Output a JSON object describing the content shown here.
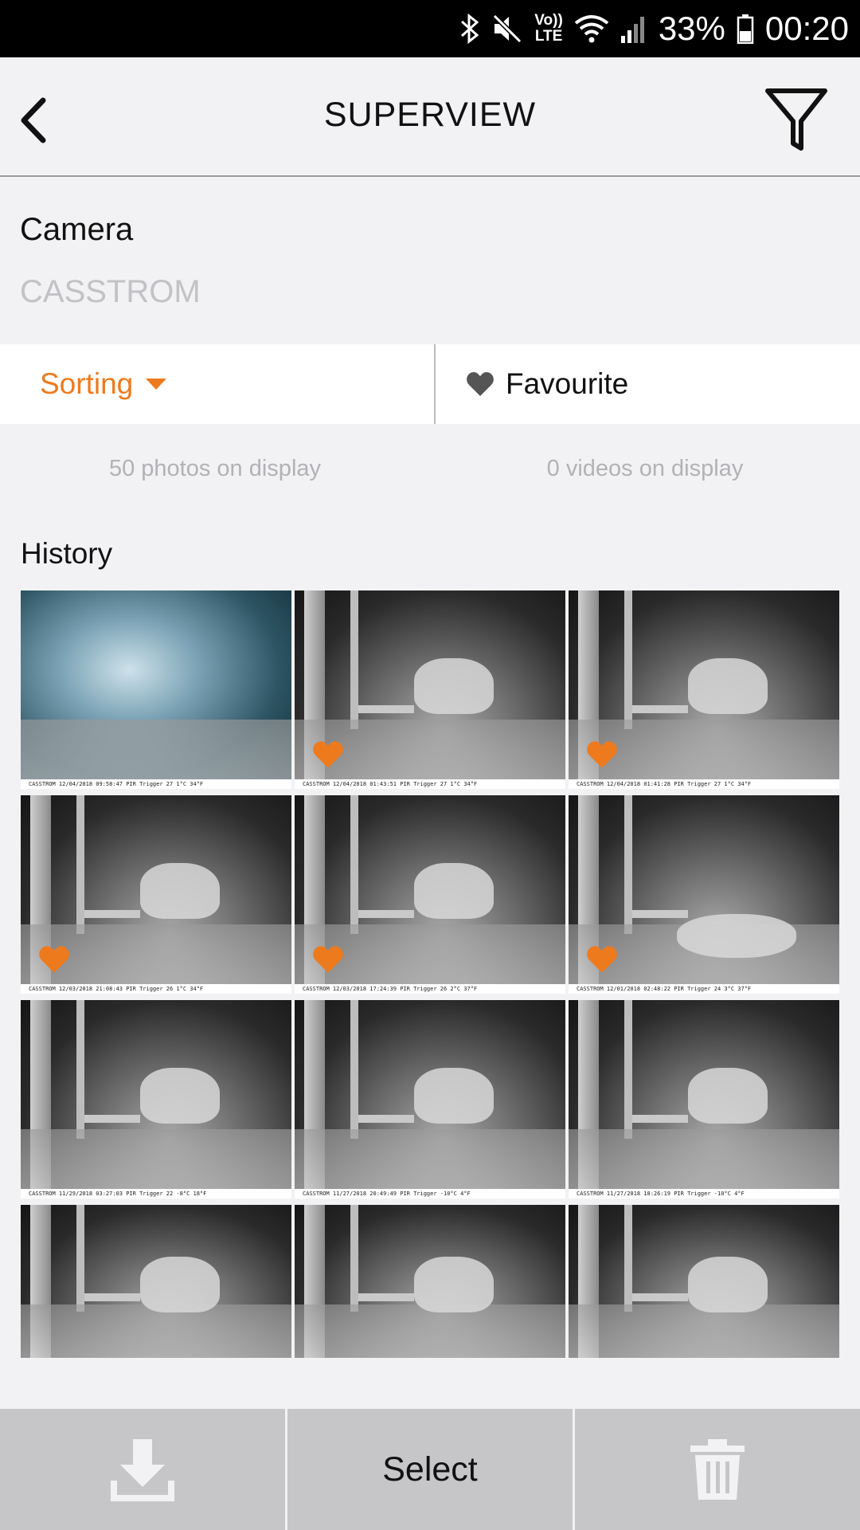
{
  "status_bar": {
    "lte_top": "Vo))",
    "lte_bottom": "LTE",
    "battery_percent": "33%",
    "time": "00:20"
  },
  "header": {
    "title": "SUPERVIEW"
  },
  "camera": {
    "label": "Camera",
    "value": "CASSTROM"
  },
  "tabs": {
    "sorting": "Sorting",
    "favourite": "Favourite"
  },
  "counts": {
    "photos": "50 photos on display",
    "videos": "0 videos on display"
  },
  "history": {
    "label": "History"
  },
  "thumbnails": [
    {
      "stamp": "CASSTROM   12/04/2018 09:58:47   PIR Trigger  27 1°C 34°F",
      "favourite": false
    },
    {
      "stamp": "CASSTROM   12/04/2018 01:43:51   PIR Trigger  27 1°C 34°F",
      "favourite": true
    },
    {
      "stamp": "CASSTROM   12/04/2018 01:41:28   PIR Trigger  27 1°C 34°F",
      "favourite": true
    },
    {
      "stamp": "CASSTROM   12/03/2018 21:08:43   PIR Trigger  26 1°C 34°F",
      "favourite": true
    },
    {
      "stamp": "CASSTROM   12/03/2018 17:24:39   PIR Trigger  26 2°C 37°F",
      "favourite": true
    },
    {
      "stamp": "CASSTROM   12/01/2018 02:48:22   PIR Trigger  24 3°C 37°F",
      "favourite": true
    },
    {
      "stamp": "CASSTROM   11/29/2018 03:27:03   PIR Trigger  22 -8°C 18°F",
      "favourite": false
    },
    {
      "stamp": "CASSTROM   11/27/2018 20:49:49   PIR Trigger  -10°C 4°F",
      "favourite": false
    },
    {
      "stamp": "CASSTROM   11/27/2018 18:26:19   PIR Trigger  -10°C 4°F",
      "favourite": false
    },
    {
      "stamp": "",
      "favourite": false
    },
    {
      "stamp": "",
      "favourite": false
    },
    {
      "stamp": "",
      "favourite": false
    }
  ],
  "bottom_bar": {
    "download_icon": "download-icon",
    "select": "Select",
    "delete_icon": "trash-icon"
  },
  "colors": {
    "accent": "#ee7a1e",
    "background": "#f2f2f4",
    "bottom_bar": "#c6c6c9"
  }
}
